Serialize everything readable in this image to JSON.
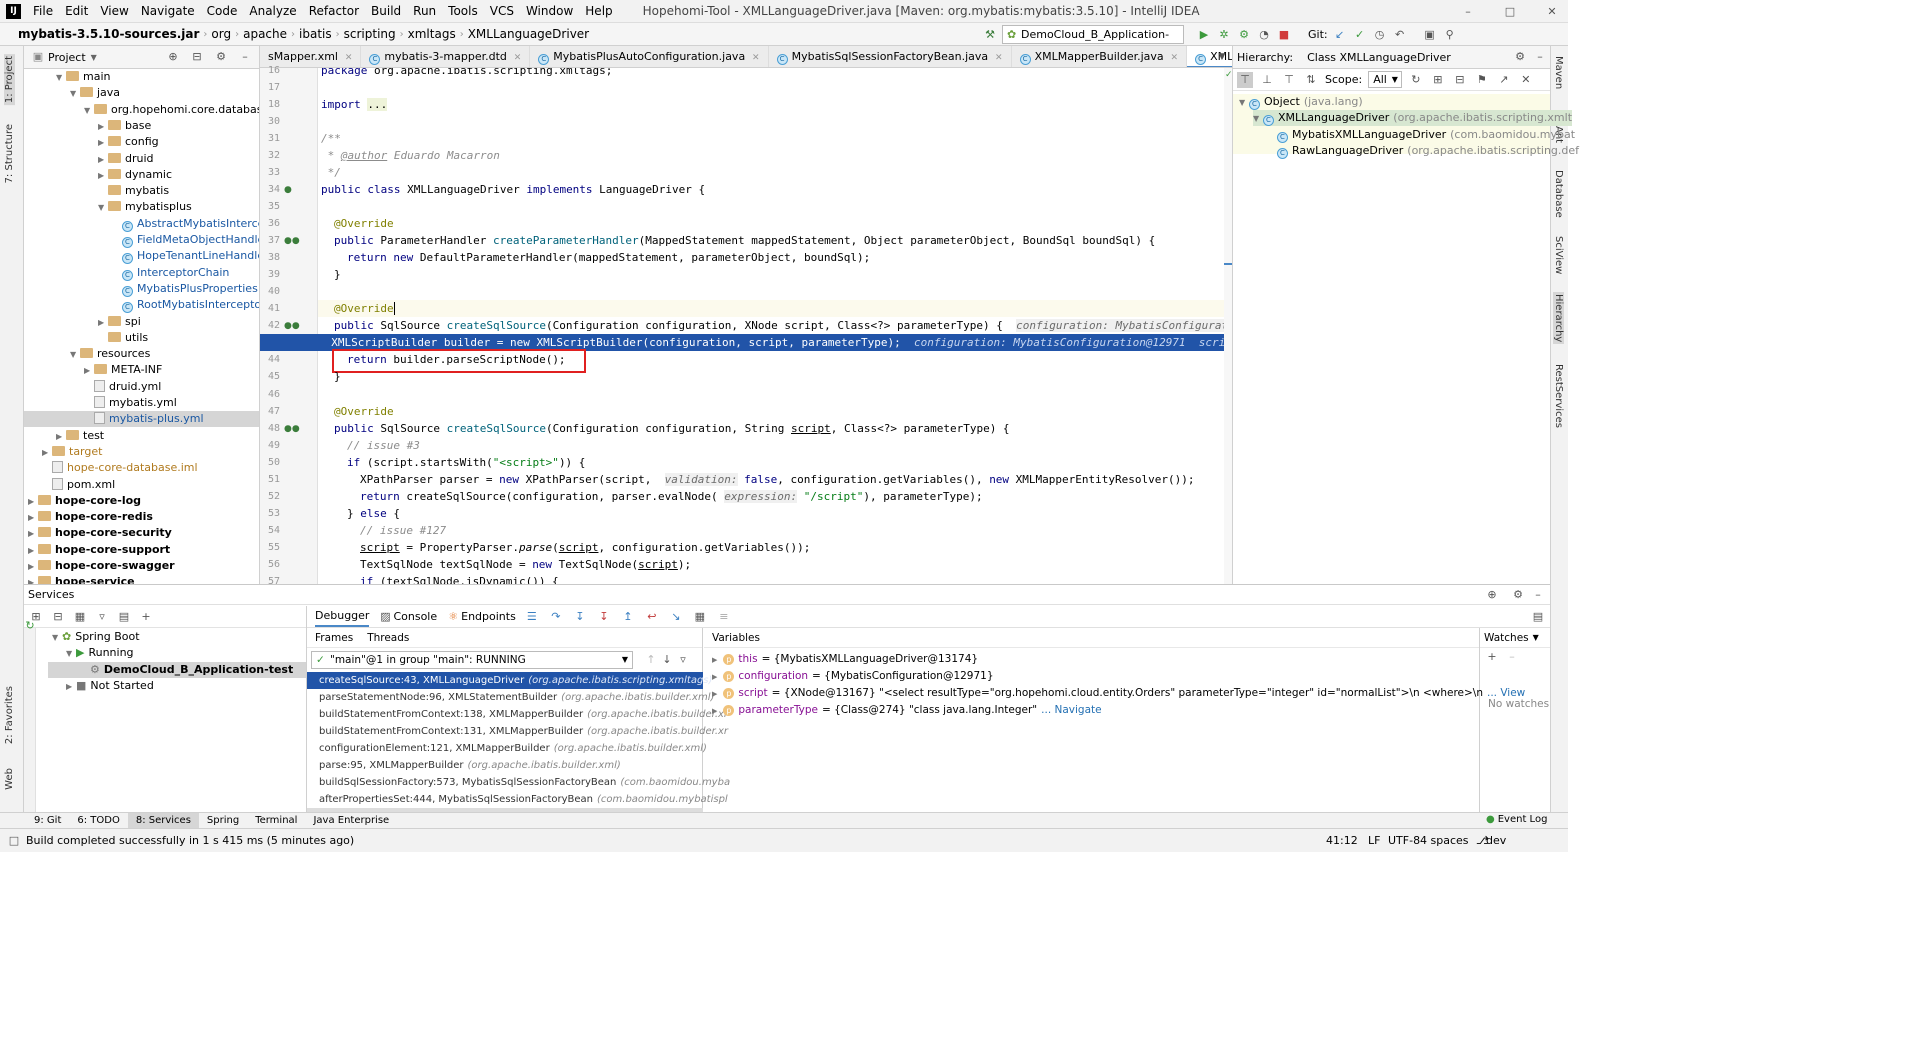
{
  "window": {
    "title": "Hopehomi-Tool - XMLLanguageDriver.java [Maven: org.mybatis:mybatis:3.5.10] - IntelliJ IDEA",
    "menu": [
      "File",
      "Edit",
      "View",
      "Navigate",
      "Code",
      "Analyze",
      "Refactor",
      "Build",
      "Run",
      "Tools",
      "VCS",
      "Window",
      "Help"
    ]
  },
  "nav": {
    "crumbs": [
      "mybatis-3.5.10-sources.jar",
      "org",
      "apache",
      "ibatis",
      "scripting",
      "xmltags",
      "XMLLanguageDriver"
    ],
    "run_config": "DemoCloud_B_Application-test",
    "git_label": "Git:"
  },
  "project": {
    "header": "Project",
    "tree": [
      {
        "indent": 2,
        "label": "main",
        "type": "folder",
        "arrow": "down"
      },
      {
        "indent": 3,
        "label": "java",
        "type": "folder",
        "arrow": "down"
      },
      {
        "indent": 4,
        "label": "org.hopehomi.core.database",
        "type": "folder",
        "arrow": "down"
      },
      {
        "indent": 5,
        "label": "base",
        "type": "folder",
        "arrow": "right"
      },
      {
        "indent": 5,
        "label": "config",
        "type": "folder",
        "arrow": "right"
      },
      {
        "indent": 5,
        "label": "druid",
        "type": "folder",
        "arrow": "right"
      },
      {
        "indent": 5,
        "label": "dynamic",
        "type": "folder",
        "arrow": "right"
      },
      {
        "indent": 5,
        "label": "mybatis",
        "type": "folder",
        "arrow": ""
      },
      {
        "indent": 5,
        "label": "mybatisplus",
        "type": "folder",
        "arrow": "down"
      },
      {
        "indent": 6,
        "label": "AbstractMybatisIntercept",
        "type": "class",
        "arrow": ""
      },
      {
        "indent": 6,
        "label": "FieldMetaObjectHandler",
        "type": "class",
        "arrow": ""
      },
      {
        "indent": 6,
        "label": "HopeTenantLineHandler",
        "type": "class",
        "arrow": ""
      },
      {
        "indent": 6,
        "label": "InterceptorChain",
        "type": "class",
        "arrow": ""
      },
      {
        "indent": 6,
        "label": "MybatisPlusProperties",
        "type": "class",
        "arrow": ""
      },
      {
        "indent": 6,
        "label": "RootMybatisInterceptor",
        "type": "class",
        "arrow": ""
      },
      {
        "indent": 5,
        "label": "spi",
        "type": "folder",
        "arrow": "right"
      },
      {
        "indent": 5,
        "label": "utils",
        "type": "folder",
        "arrow": ""
      },
      {
        "indent": 3,
        "label": "resources",
        "type": "folder",
        "arrow": "down"
      },
      {
        "indent": 4,
        "label": "META-INF",
        "type": "folder",
        "arrow": "right"
      },
      {
        "indent": 4,
        "label": "druid.yml",
        "type": "yml",
        "arrow": ""
      },
      {
        "indent": 4,
        "label": "mybatis.yml",
        "type": "yml",
        "arrow": ""
      },
      {
        "indent": 4,
        "label": "mybatis-plus.yml",
        "type": "yml",
        "arrow": "",
        "selected": true
      },
      {
        "indent": 2,
        "label": "test",
        "type": "folder",
        "arrow": "right"
      },
      {
        "indent": 1,
        "label": "target",
        "type": "folder",
        "arrow": "right"
      },
      {
        "indent": 1,
        "label": "hope-core-database.iml",
        "type": "file",
        "arrow": ""
      },
      {
        "indent": 1,
        "label": "pom.xml",
        "type": "file",
        "arrow": ""
      },
      {
        "indent": 0,
        "label": "hope-core-log",
        "type": "module",
        "arrow": "right"
      },
      {
        "indent": 0,
        "label": "hope-core-redis",
        "type": "module",
        "arrow": "right"
      },
      {
        "indent": 0,
        "label": "hope-core-security",
        "type": "module",
        "arrow": "right"
      },
      {
        "indent": 0,
        "label": "hope-core-support",
        "type": "module",
        "arrow": "right"
      },
      {
        "indent": 0,
        "label": "hope-core-swagger",
        "type": "module",
        "arrow": "right"
      },
      {
        "indent": 0,
        "label": "hope-service",
        "type": "module",
        "arrow": "right"
      }
    ]
  },
  "editor": {
    "tabs": [
      {
        "label": "sMapper.xml",
        "active": false
      },
      {
        "label": "mybatis-3-mapper.dtd",
        "active": false
      },
      {
        "label": "MybatisPlusAutoConfiguration.java",
        "active": false
      },
      {
        "label": "MybatisSqlSessionFactoryBean.java",
        "active": false
      },
      {
        "label": "XMLMapperBuilder.java",
        "active": false
      },
      {
        "label": "XMLLanguageDriver.java",
        "active": true
      }
    ],
    "line_numbers": [
      "16",
      "17",
      "18",
      "30",
      "31",
      "32",
      "33",
      "34",
      "35",
      "36",
      "37",
      "38",
      "39",
      "40",
      "41",
      "42",
      "43",
      "44",
      "45",
      "46",
      "47",
      "48",
      "49",
      "50",
      "51",
      "52",
      "53",
      "54",
      "55",
      "56",
      "57"
    ]
  },
  "hierarchy": {
    "title": "Hierarchy:",
    "subject": "Class XMLLanguageDriver",
    "scope_label": "Scope:",
    "scope_value": "All",
    "items": [
      {
        "name": "Object",
        "pkg": "(java.lang)",
        "indent": 0
      },
      {
        "name": "XMLLanguageDriver",
        "pkg": "(org.apache.ibatis.scripting.xmlt",
        "indent": 1
      },
      {
        "name": "MybatisXMLLanguageDriver",
        "pkg": "(com.baomidou.mybat",
        "indent": 2
      },
      {
        "name": "RawLanguageDriver",
        "pkg": "(org.apache.ibatis.scripting.def",
        "indent": 2
      }
    ]
  },
  "services": {
    "title": "Services",
    "tree": [
      {
        "label": "Spring Boot",
        "indent": 0
      },
      {
        "label": "Running",
        "indent": 1
      },
      {
        "label": "DemoCloud_B_Application-test",
        "indent": 2,
        "selected": true
      },
      {
        "label": "Not Started",
        "indent": 1
      }
    ],
    "debugger_tabs": [
      "Debugger",
      "Console",
      "Endpoints"
    ],
    "frames_tab": "Frames",
    "threads_tab": "Threads",
    "thread": "\"main\"@1 in group \"main\": RUNNING",
    "frames": [
      {
        "method": "createSqlSource:43, XMLLanguageDriver",
        "pkg": "(org.apache.ibatis.scripting.xmltags)",
        "selected": true
      },
      {
        "method": "parseStatementNode:96, XMLStatementBuilder",
        "pkg": "(org.apache.ibatis.builder.xml)"
      },
      {
        "method": "buildStatementFromContext:138, XMLMapperBuilder",
        "pkg": "(org.apache.ibatis.builder.xr"
      },
      {
        "method": "buildStatementFromContext:131, XMLMapperBuilder",
        "pkg": "(org.apache.ibatis.builder.xr"
      },
      {
        "method": "configurationElement:121, XMLMapperBuilder",
        "pkg": "(org.apache.ibatis.builder.xml)"
      },
      {
        "method": "parse:95, XMLMapperBuilder",
        "pkg": "(org.apache.ibatis.builder.xml)"
      },
      {
        "method": "buildSqlSessionFactory:573, MybatisSqlSessionFactoryBean",
        "pkg": "(com.baomidou.myba"
      },
      {
        "method": "afterPropertiesSet:444, MybatisSqlSessionFactoryBean",
        "pkg": "(com.baomidou.mybatispl"
      }
    ],
    "variables_title": "Variables",
    "variables": [
      {
        "name": "this",
        "value": "= {MybatisXMLLanguageDriver@13174}",
        "extra": ""
      },
      {
        "name": "configuration",
        "value": "= {MybatisConfiguration@12971}",
        "extra": ""
      },
      {
        "name": "script",
        "value": "= {XNode@13167} \"<select resultType=\"org.hopehomi.cloud.entity.Orders\" parameterType=\"integer\" id=\"normalList\">\\n    <where>\\n",
        "extra": "... View"
      },
      {
        "name": "parameterType",
        "value": "= {Class@274} \"class java.lang.Integer\"",
        "extra": "... Navigate"
      }
    ],
    "watches_title": "Watches",
    "no_watches": "No watches"
  },
  "bottom_tabs": [
    "9: Git",
    "6: TODO",
    "8: Services",
    "Spring",
    "Terminal",
    "Java Enterprise"
  ],
  "event_log": "Event Log",
  "status": {
    "message": "Build completed successfully in 1 s 415 ms (5 minutes ago)",
    "position": "41:12",
    "line_sep": "LF",
    "encoding": "UTF-8",
    "indent": "4 spaces",
    "branch": "dev"
  },
  "left_tool_tabs": [
    "1: Project",
    "7: Structure",
    "2: Favorites",
    "Web"
  ],
  "right_tool_tabs": [
    "Maven",
    "Ant",
    "Database",
    "SciView",
    "Hierarchy",
    "RestServices"
  ]
}
